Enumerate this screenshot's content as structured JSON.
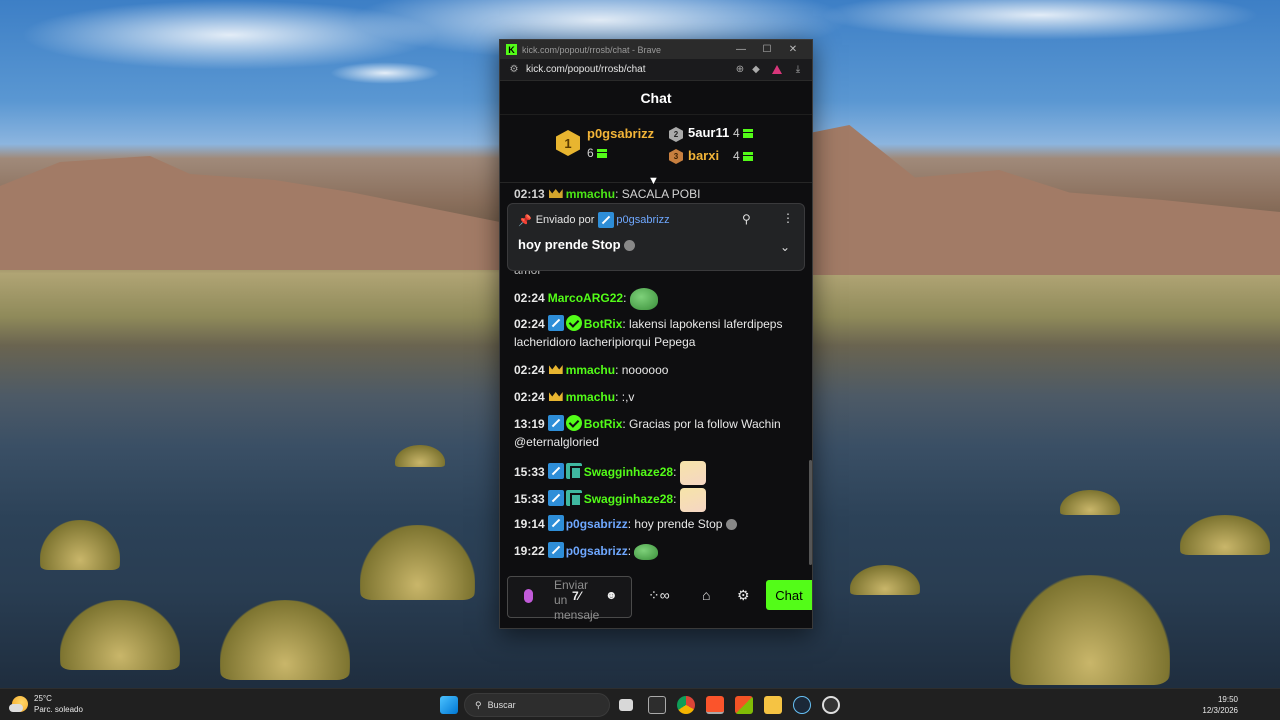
{
  "browser": {
    "title": "kick.com/popout/rrosb/chat - Brave",
    "url": "kick.com/popout/rrosb/chat",
    "minimize": "—",
    "maximize": "☐",
    "close": "✕"
  },
  "chat_header": "Chat",
  "leaderboard": [
    {
      "rank": "1",
      "name": "p0gsabrizz",
      "count": "6"
    },
    {
      "rank": "2",
      "name": "5aur11",
      "count": "4"
    },
    {
      "rank": "3",
      "name": "barxi",
      "count": "4"
    }
  ],
  "pinned": {
    "label": "Enviado por",
    "user": "p0gsabrizz",
    "message": "hoy prende Stop"
  },
  "partial_top": {
    "time": "02:13",
    "user": "mmachu",
    "text": "SACALA POBI"
  },
  "partial_under_pin": "amor",
  "messages": [
    {
      "time": "02:24",
      "user": "MarcoARG22",
      "text": ""
    },
    {
      "time": "02:24",
      "user": "BotRix",
      "text": "lakensi lapokensi laferdipeps lacheridioro lacheripiorqui Pepega"
    },
    {
      "time": "02:24",
      "user": "mmachu",
      "text": "noooooo"
    },
    {
      "time": "02:24",
      "user": "mmachu",
      "text": ":,v"
    },
    {
      "time": "13:19",
      "user": "BotRix",
      "text": "Gracias por la follow Wachin @eternalgloried"
    },
    {
      "time": "15:33",
      "user": "Swagginhaze28",
      "text": ""
    },
    {
      "time": "15:33",
      "user": "Swagginhaze28",
      "text": ""
    },
    {
      "time": "19:14",
      "user": "p0gsabrizz",
      "text": "hoy prende Stop"
    },
    {
      "time": "19:22",
      "user": "p0gsabrizz",
      "text": ""
    }
  ],
  "input": {
    "placeholder": "Enviar un mensaje"
  },
  "send_button": "Chat",
  "taskbar": {
    "temperature": "25°C",
    "condition": "Parc. soleado",
    "search": "Buscar",
    "time": "19:50",
    "date": "12/3/2026"
  },
  "colors": {
    "kick_green": "#53fc18",
    "staff_blue": "#2e8ed8",
    "crown_gold": "#e8b530"
  }
}
